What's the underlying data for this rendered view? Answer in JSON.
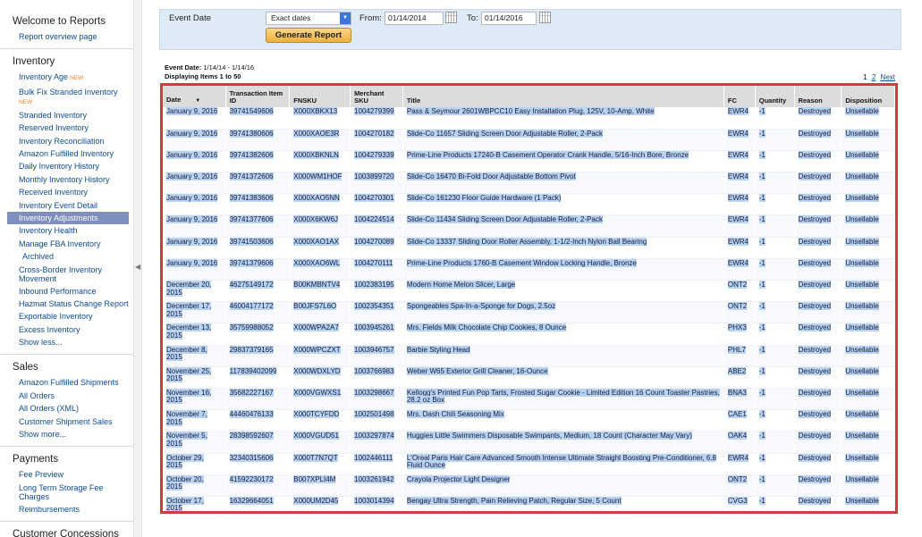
{
  "sidebar": {
    "welcome": {
      "heading": "Welcome to Reports",
      "items": [
        "Report overview page"
      ]
    },
    "inventory": {
      "heading": "Inventory",
      "items": [
        "Inventory Age",
        "Bulk Fix Stranded Inventory",
        "Stranded Inventory",
        "Reserved Inventory",
        "Inventory Reconciliation",
        "Amazon Fulfilled Inventory",
        "Daily Inventory History",
        "Monthly Inventory History",
        "Received Inventory",
        "Inventory Event Detail",
        "Inventory Adjustments",
        "Inventory Health",
        "Manage FBA Inventory",
        "Archived",
        "Cross-Border Inventory Movement",
        "Inbound Performance",
        "Hazmat Status Change Report",
        "Exportable Inventory",
        "Excess Inventory",
        "Show less..."
      ],
      "new_tag": "NEW"
    },
    "sales": {
      "heading": "Sales",
      "items": [
        "Amazon Fulfilled Shipments",
        "All Orders",
        "All Orders (XML)",
        "Customer Shipment Sales",
        "Show more..."
      ]
    },
    "payments": {
      "heading": "Payments",
      "items": [
        "Fee Preview",
        "Long Term Storage Fee Charges",
        "Reimbursements"
      ]
    },
    "concessions": {
      "heading": "Customer Concessions"
    }
  },
  "filters": {
    "event_date_label": "Event Date",
    "event_select_value": "Exact dates",
    "from_label": "From:",
    "from_value": "01/14/2014",
    "to_label": "To:",
    "to_value": "01/14/2016",
    "generate_label": "Generate Report"
  },
  "summary": {
    "event_date_label": "Event Date:",
    "event_date_value": "1/14/14 - 1/14/16",
    "displaying": "Displaying Items 1 to 50"
  },
  "pager": {
    "pages": [
      "1",
      "2"
    ],
    "next": "Next"
  },
  "table": {
    "headers": [
      "Date",
      "Transaction Item ID",
      "FNSKU",
      "Merchant SKU",
      "Title",
      "FC",
      "Quantity",
      "Reason",
      "Disposition"
    ],
    "rows": [
      [
        "January 9, 2016",
        "39741549606",
        "X000XBKX13",
        "1004279399",
        "Pass & Seymour 2601WBPCC10 Easy Installation Plug, 125V, 10-Amp, White",
        "EWR4",
        "-1",
        "Destroyed",
        "Unsellable"
      ],
      [
        "January 9, 2016",
        "39741380606",
        "X000XAOE3R",
        "1004270182",
        "Slide-Co 11657 Sliding Screen Door Adjustable Roller, 2-Pack",
        "EWR4",
        "-1",
        "Destroyed",
        "Unsellable"
      ],
      [
        "January 9, 2016",
        "39741382606",
        "X000XBKNLN",
        "1004279339",
        "Prime-Line Products 17240-B Casement Operator Crank Handle, 5/16-Inch Bore, Bronze",
        "EWR4",
        "-1",
        "Destroyed",
        "Unsellable"
      ],
      [
        "January 9, 2016",
        "39741372606",
        "X000WM1HOF",
        "1003899720",
        "Slide-Co 16470 Bi-Fold Door Adjustable Bottom Pivot",
        "EWR4",
        "-1",
        "Destroyed",
        "Unsellable"
      ],
      [
        "January 9, 2016",
        "39741383606",
        "X000XAO5NN",
        "1004270301",
        "Slide-Co 161230 Floor Guide Hardware (1 Pack)",
        "EWR4",
        "-1",
        "Destroyed",
        "Unsellable"
      ],
      [
        "January 9, 2016",
        "39741377606",
        "X000X6KW6J",
        "1004224514",
        "Slide-Co 11434 Sliding Screen Door Adjustable Roller, 2-Pack",
        "EWR4",
        "-1",
        "Destroyed",
        "Unsellable"
      ],
      [
        "January 9, 2016",
        "39741503606",
        "X000XAO1AX",
        "1004270089",
        "Slide-Co 13337 Sliding Door Roller Assembly, 1-1/2-Inch Nylon Ball Bearing",
        "EWR4",
        "-1",
        "Destroyed",
        "Unsellable"
      ],
      [
        "January 9, 2016",
        "39741379606",
        "X000XAO6WL",
        "1004270111",
        "Prime-Line Products 1760-B Casement Window Locking Handle, Bronze",
        "EWR4",
        "-1",
        "Destroyed",
        "Unsellable"
      ],
      [
        "December 20, 2015",
        "46275149172",
        "B00KMBNTV4",
        "1002383195",
        "Modern Home Melon Slicer, Large",
        "ONT2",
        "-1",
        "Destroyed",
        "Unsellable"
      ],
      [
        "December 17, 2015",
        "46004177172",
        "B00JFS7L6O",
        "1002354351",
        "Spongeables Spa-In-a-Sponge for Dogs, 2.5oz",
        "ONT2",
        "-1",
        "Destroyed",
        "Unsellable"
      ],
      [
        "December 13, 2015",
        "35759988052",
        "X000WPA2A7",
        "1003945261",
        "Mrs. Fields Milk Chocolate Chip Cookies, 8 Ounce",
        "PHX3",
        "-1",
        "Destroyed",
        "Unsellable"
      ],
      [
        "December 8, 2015",
        "29837379165",
        "X000WPCZXT",
        "1003946757",
        "Barbie Styling Head",
        "PHL7",
        "-1",
        "Destroyed",
        "Unsellable"
      ],
      [
        "November 25, 2015",
        "117839402099",
        "X000WDXLYD",
        "1003766983",
        "Weber W65 Exterior Grill Cleaner, 16-Ounce",
        "ABE2",
        "-1",
        "Destroyed",
        "Unsellable"
      ],
      [
        "November 16, 2015",
        "35682227167",
        "X000VGWXS1",
        "1003298667",
        "Kellogg's Printed Fun Pop Tarts, Frosted Sugar Cookie - Limited Edition 16 Count Toaster Pastries, 28.2 oz Box",
        "BNA3",
        "-1",
        "Destroyed",
        "Unsellable"
      ],
      [
        "November 7, 2015",
        "44460476133",
        "X000TCYFDD",
        "1002501498",
        "Mrs. Dash Chili Seasoning Mix",
        "CAE1",
        "-1",
        "Destroyed",
        "Unsellable"
      ],
      [
        "November 5, 2015",
        "28398592607",
        "X000VGUD51",
        "1003297874",
        "Huggies Little Swimmers Disposable Swimpants, Medium, 18 Count (Character May Vary)",
        "OAK4",
        "-1",
        "Destroyed",
        "Unsellable"
      ],
      [
        "October 29, 2015",
        "32340315606",
        "X000T7N7QT",
        "1002446111",
        "L'Oreal Paris Hair Care Advanced Smooth Intense Ultimate Straight Boosting Pre-Conditioner, 6.8 Fluid Ounce",
        "EWR4",
        "-1",
        "Destroyed",
        "Unsellable"
      ],
      [
        "October 20, 2015",
        "41592230172",
        "B007XPLI4M",
        "1003261942",
        "Crayola Projector Light Designer",
        "ONT2",
        "-1",
        "Destroyed",
        "Unsellable"
      ],
      [
        "October 17, 2015",
        "16329664051",
        "X000UM2D45",
        "1003014394",
        "Bengay Ultra Strength, Pain Relieving Patch, Regular Size, 5 Count",
        "CVG3",
        "-1",
        "Destroyed",
        "Unsellable"
      ]
    ]
  }
}
